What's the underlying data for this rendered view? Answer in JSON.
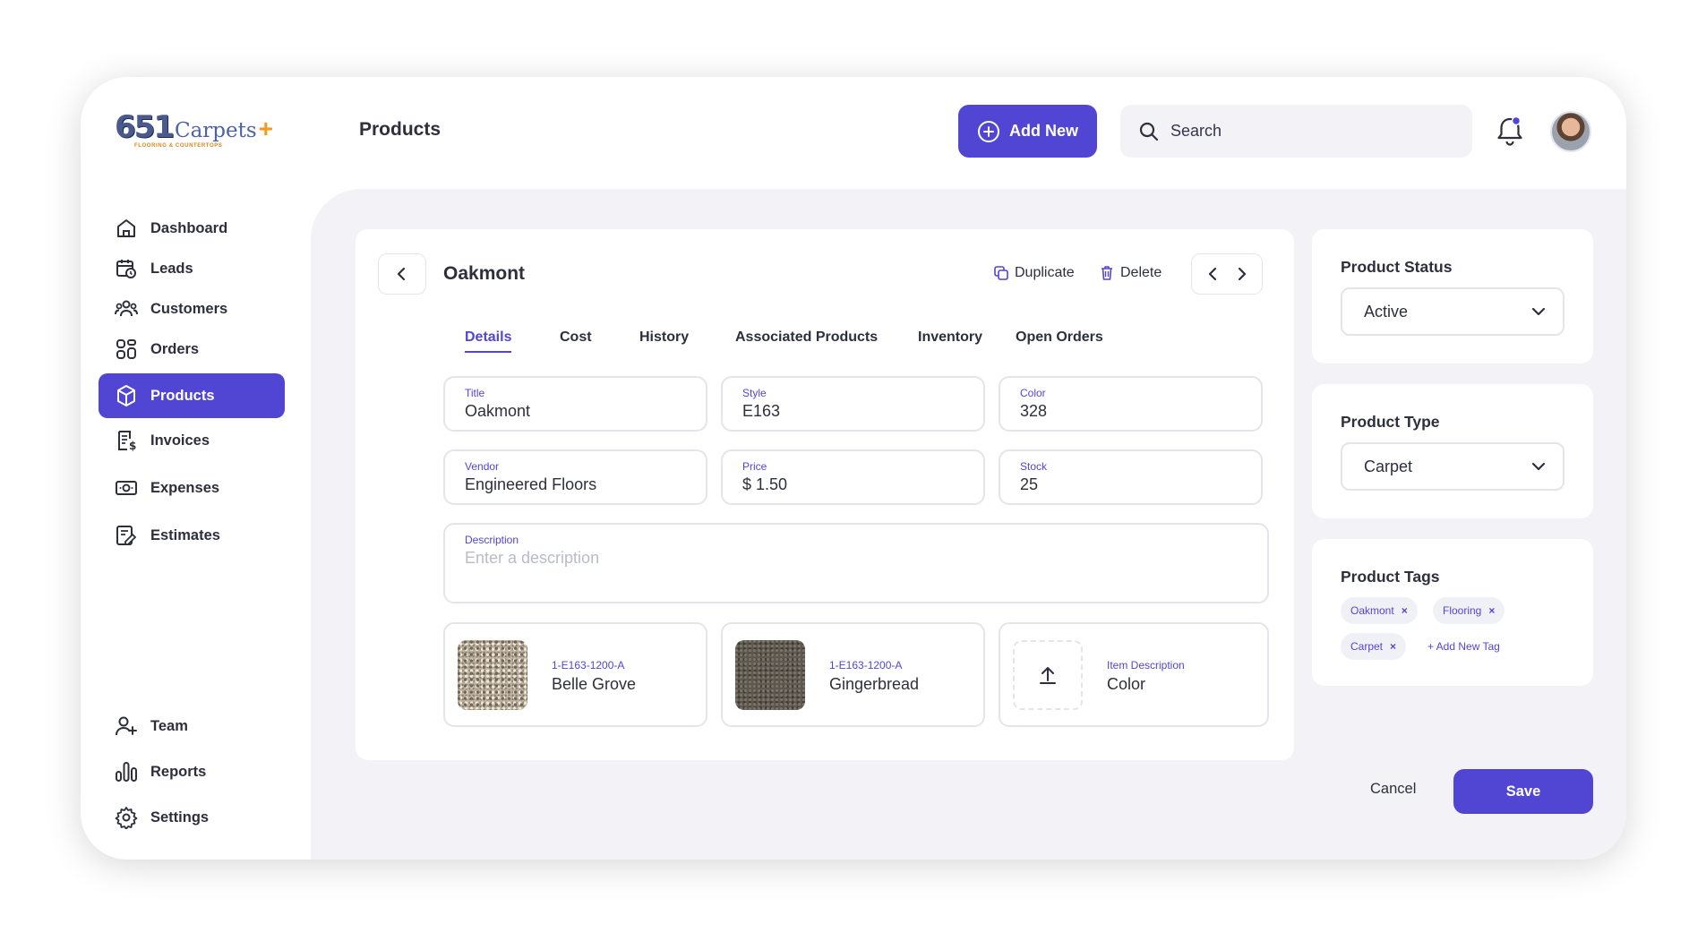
{
  "logo": {
    "number": "651",
    "word": "Carpets",
    "plus": "+",
    "tagline": "FLOORING & COUNTERTOPS"
  },
  "header": {
    "title": "Products",
    "add_new_label": "Add New",
    "search_placeholder": "Search",
    "notification_icon": "bell-icon",
    "notification_dot_color": "#5146d4"
  },
  "sidebar": {
    "items": [
      {
        "label": "Dashboard",
        "icon": "home-icon"
      },
      {
        "label": "Leads",
        "icon": "calendar-clock-icon"
      },
      {
        "label": "Customers",
        "icon": "users-icon"
      },
      {
        "label": "Orders",
        "icon": "grid-icon"
      },
      {
        "label": "Products",
        "icon": "cube-icon",
        "active": true
      },
      {
        "label": "Invoices",
        "icon": "invoice-icon"
      },
      {
        "label": "Expenses",
        "icon": "money-icon"
      },
      {
        "label": "Estimates",
        "icon": "estimate-icon"
      }
    ],
    "bottom_items": [
      {
        "label": "Team",
        "icon": "user-plus-icon"
      },
      {
        "label": "Reports",
        "icon": "bar-chart-icon"
      },
      {
        "label": "Settings",
        "icon": "gear-icon"
      }
    ]
  },
  "product": {
    "name": "Oakmont",
    "duplicate_label": "Duplicate",
    "delete_label": "Delete",
    "tabs": [
      "Details",
      "Cost",
      "History",
      "Associated Products",
      "Inventory",
      "Open Orders"
    ],
    "active_tab": "Details",
    "fields": {
      "title": {
        "label": "Title",
        "value": "Oakmont"
      },
      "style": {
        "label": "Style",
        "value": "E163"
      },
      "color": {
        "label": "Color",
        "value": "328"
      },
      "vendor": {
        "label": "Vendor",
        "value": "Engineered Floors"
      },
      "price": {
        "label": "Price",
        "value": "$ 1.50"
      },
      "stock": {
        "label": "Stock",
        "value": "25"
      },
      "description": {
        "label": "Description",
        "placeholder": "Enter a description"
      }
    },
    "variants": [
      {
        "code": "1-E163-1200-A",
        "name": "Belle Grove"
      },
      {
        "code": "1-E163-1200-A",
        "name": "Gingerbread"
      },
      {
        "code": "Item Description",
        "name": "Color"
      }
    ]
  },
  "status_panel": {
    "title": "Product Status",
    "value": "Active"
  },
  "type_panel": {
    "title": "Product Type",
    "value": "Carpet"
  },
  "tags_panel": {
    "title": "Product Tags",
    "tags": [
      "Oakmont",
      "Flooring",
      "Carpet"
    ],
    "add_label": "+ Add New Tag"
  },
  "footer": {
    "cancel_label": "Cancel",
    "save_label": "Save"
  },
  "colors": {
    "accent": "#5146d4",
    "background": "#f3f3f7",
    "border": "#e4e4ec"
  }
}
